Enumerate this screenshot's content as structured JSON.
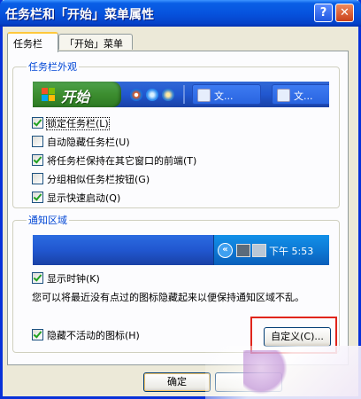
{
  "window": {
    "title": "任务栏和「开始」菜单属性",
    "help_label": "?",
    "close_label": "✕"
  },
  "tabs": [
    {
      "label": "任务栏",
      "active": true
    },
    {
      "label": "「开始」菜单",
      "active": false
    }
  ],
  "taskbar_appearance": {
    "legend": "任务栏外观",
    "preview": {
      "start_label": "开始",
      "task_buttons": [
        "文...",
        "文..."
      ]
    },
    "options": [
      {
        "label": "锁定任务栏(L)",
        "checked": true
      },
      {
        "label": "自动隐藏任务栏(U)",
        "checked": false
      },
      {
        "label": "将任务栏保持在其它窗口的前端(T)",
        "checked": true
      },
      {
        "label": "分组相似任务栏按钮(G)",
        "checked": false
      },
      {
        "label": "显示快速启动(Q)",
        "checked": true
      }
    ]
  },
  "notification_area": {
    "legend": "通知区域",
    "preview": {
      "arrow": "«",
      "clock": "下午 5:53"
    },
    "show_clock": {
      "label": "显示时钟(K)",
      "checked": true
    },
    "info_text": "您可以将最近没有点过的图标隐藏起来以便保持通知区域不乱。",
    "hide_inactive": {
      "label": "隐藏不活动的图标(H)",
      "checked": true
    },
    "customize_label": "自定义(C)..."
  },
  "buttons": {
    "ok_label": "确定",
    "cancel_label": ""
  },
  "colors": {
    "highlight_box": "#e0251b",
    "title_bar": "#0653de"
  }
}
